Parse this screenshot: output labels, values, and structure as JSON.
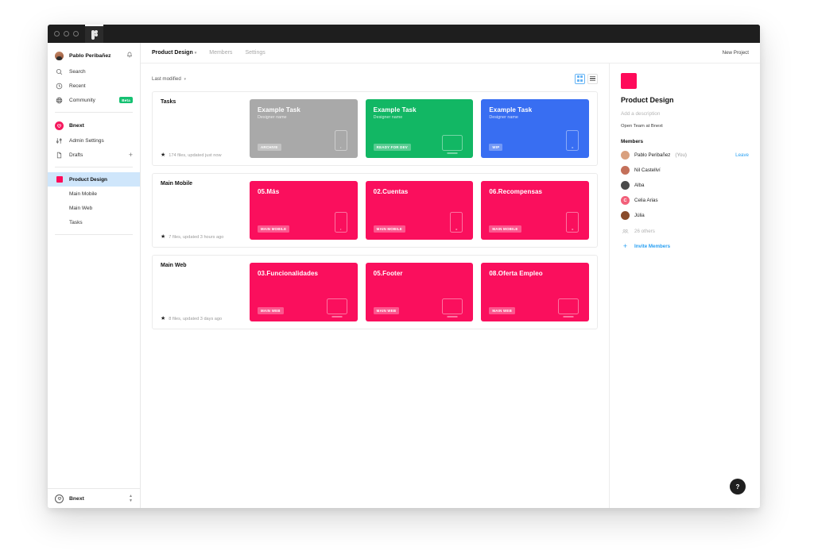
{
  "window": {
    "traffic_lights": [
      "close",
      "minimize",
      "maximize"
    ],
    "tab_icon": "figma-icon"
  },
  "sidebar": {
    "user": {
      "name": "Pablo Peribañez",
      "bell_icon": "bell-icon",
      "avatar": "user-avatar"
    },
    "nav": [
      {
        "label": "Search",
        "icon": "search-icon"
      },
      {
        "label": "Recent",
        "icon": "clock-icon"
      },
      {
        "label": "Community",
        "icon": "globe-icon",
        "badge": "Beta"
      }
    ],
    "team": {
      "label": "Bnext",
      "icon": "bnext-logo-icon"
    },
    "team_nav": [
      {
        "label": "Admin Settings",
        "icon": "sliders-icon"
      },
      {
        "label": "Drafts",
        "icon": "file-icon",
        "action": "+"
      }
    ],
    "projects": [
      {
        "label": "Product Design",
        "icon": "project-square-icon",
        "active": true
      },
      {
        "label": "Main Mobile",
        "active": false
      },
      {
        "label": "Main Web",
        "active": false
      },
      {
        "label": "Tasks",
        "active": false
      }
    ],
    "footer": {
      "label": "Bnext",
      "icon": "bnext-logo-icon",
      "stepper_icon": "chevron-updown-icon"
    }
  },
  "topbar": {
    "tabs": [
      {
        "label": "Product Design",
        "active": true,
        "caret": "▾"
      },
      {
        "label": "Members",
        "active": false
      },
      {
        "label": "Settings",
        "active": false
      }
    ],
    "new_project_label": "New Project"
  },
  "toolbar": {
    "sort_label": "Last modified",
    "sort_caret": "▾",
    "view_grid": "grid-view-icon",
    "view_list": "list-view-icon",
    "active_view": "grid"
  },
  "sections": [
    {
      "title": "Tasks",
      "files_text": "174 files, updated just now",
      "cards": [
        {
          "title": "Example Task",
          "subtitle": "Designer name",
          "badge": "ARCHIVE",
          "color": "#a9a9a9",
          "device": "phone"
        },
        {
          "title": "Example Task",
          "subtitle": "Designer name",
          "badge": "READY FOR DEV",
          "color": "#12b764",
          "device": "monitor"
        },
        {
          "title": "Example Task",
          "subtitle": "Designer name",
          "badge": "WIP",
          "color": "#386ef2",
          "device": "phone"
        }
      ]
    },
    {
      "title": "Main Mobile",
      "files_text": "7 files, updated 3 hours ago",
      "cards": [
        {
          "title": "05.Más",
          "subtitle": "",
          "badge": "MAIN MOBILE",
          "color": "#fa0f5d",
          "device": "phone"
        },
        {
          "title": "02.Cuentas",
          "subtitle": "",
          "badge": "MAIN MOBILE",
          "color": "#fa0f5d",
          "device": "phone"
        },
        {
          "title": "06.Recompensas",
          "subtitle": "",
          "badge": "MAIN MOBILE",
          "color": "#fa0f5d",
          "device": "phone"
        }
      ]
    },
    {
      "title": "Main Web",
      "files_text": "8 files, updated 3 days ago",
      "cards": [
        {
          "title": "03.Funcionalidades",
          "subtitle": "",
          "badge": "MAIN WEB",
          "color": "#fa0f5d",
          "device": "monitor"
        },
        {
          "title": "05.Footer",
          "subtitle": "",
          "badge": "MAIN WEB",
          "color": "#fa0f5d",
          "device": "monitor"
        },
        {
          "title": "08.Oferta Empleo",
          "subtitle": "",
          "badge": "MAIN WEB",
          "color": "#fa0f5d",
          "device": "monitor"
        }
      ]
    }
  ],
  "details": {
    "thumb_color": "#ff0a5a",
    "title": "Product Design",
    "description_placeholder": "Add a description",
    "team_link": "Open Team at Bnext",
    "members_heading": "Members",
    "leave_label": "Leave",
    "members": [
      {
        "name": "Pablo Peribañez",
        "suffix": "(You)",
        "avatar_color": "#d9a07e"
      },
      {
        "name": "Nil Castellví",
        "suffix": "",
        "avatar_color": "#c4705a"
      },
      {
        "name": "Alba",
        "suffix": "",
        "avatar_color": "#4a4a4a"
      },
      {
        "name": "Celia Arias",
        "suffix": "",
        "avatar_color": "#f2607a",
        "initial": "C"
      },
      {
        "name": "Júlia",
        "suffix": "",
        "avatar_color": "#8a4b2a"
      }
    ],
    "others_label": "26 others",
    "others_icon": "people-icon",
    "invite_label": "Invite Members",
    "invite_icon": "plus-icon"
  },
  "help": {
    "label": "?",
    "icon": "help-icon"
  }
}
